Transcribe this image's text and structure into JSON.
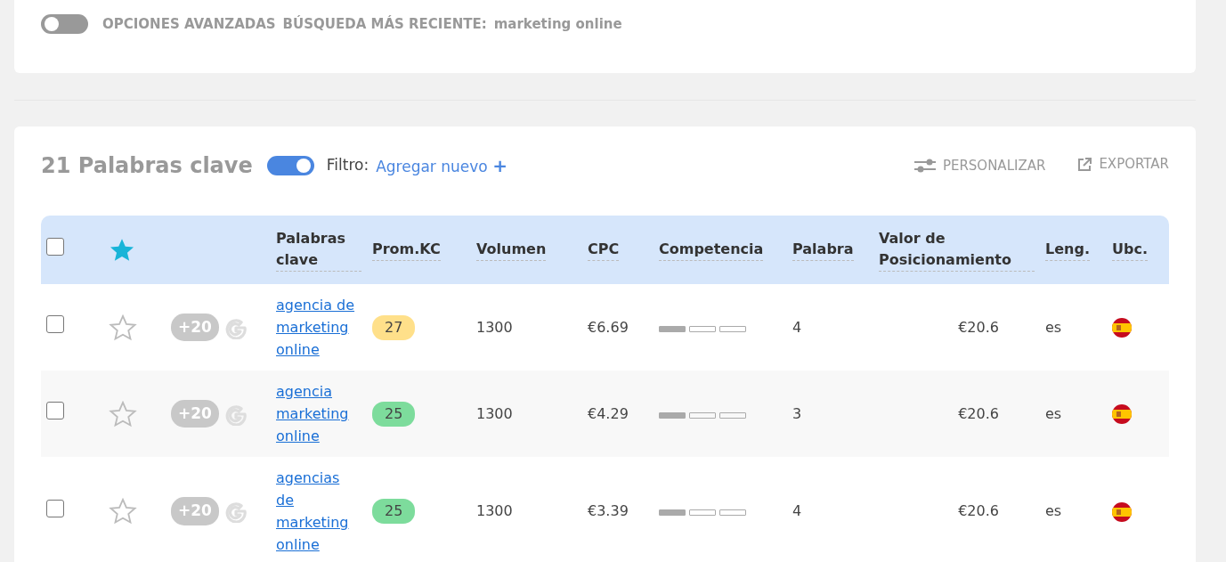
{
  "top_panel": {
    "advanced_options": {
      "label": "OPCIONES AVANZADAS",
      "on": false
    },
    "recent_search": {
      "label": "BÚSQUEDA MÁS RECIENTE:",
      "value": "marketing online"
    }
  },
  "results": {
    "select_all": false,
    "title": "21 Palabras clave",
    "toggle_on": true,
    "filter_label": "Filtro:",
    "add_filter": "Agregar nuevo",
    "add_icon": "+",
    "actions": [
      "PERSONALIZAR",
      "EXPORTAR"
    ],
    "columns": [
      "Palabras clave",
      "Prom.KC",
      "Volumen",
      "CPC",
      "Competencia",
      "Palabra",
      "Valor de Posicionamiento",
      "Leng.",
      "Ubc."
    ],
    "rows": [
      {
        "checked": false,
        "starred": false,
        "extra": "+20",
        "keyword": "agencia de marketing online",
        "kc": "27",
        "color": "#ffe08a",
        "volume": "1300",
        "cpc": "€6.69",
        "level": 0.33,
        "words": "4",
        "value": "€20.6",
        "lang": "es"
      },
      {
        "checked": false,
        "starred": false,
        "extra": "+20",
        "keyword": "agencia marketing online",
        "kc": "25",
        "color": "#7ddc9c",
        "volume": "1300",
        "cpc": "€4.29",
        "level": 0.33,
        "words": "3",
        "value": "€20.6",
        "lang": "es"
      },
      {
        "checked": false,
        "starred": false,
        "extra": "+20",
        "keyword": "agencias de marketing online",
        "kc": "25",
        "color": "#7ddc9c",
        "volume": "1300",
        "cpc": "€3.39",
        "level": 0.33,
        "words": "4",
        "value": "€20.6",
        "lang": "es"
      }
    ]
  }
}
